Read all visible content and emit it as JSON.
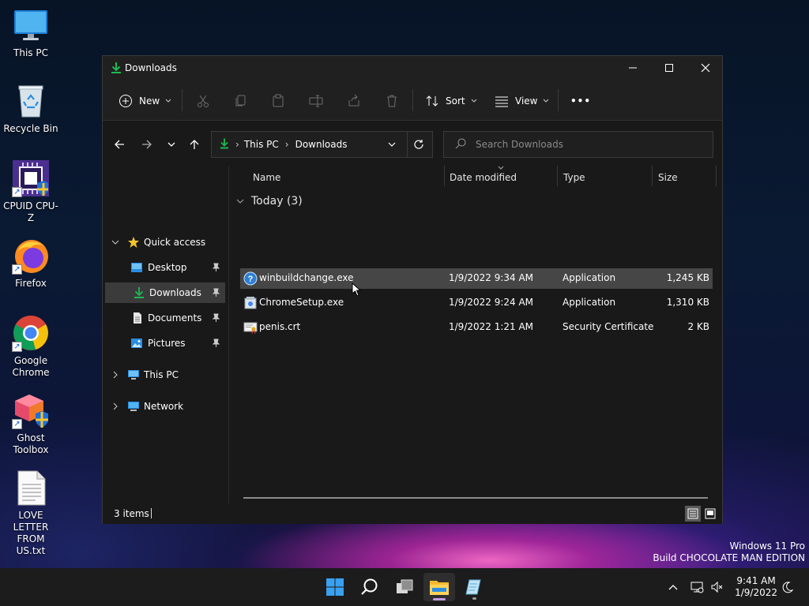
{
  "desktop": {
    "icons": [
      {
        "label": "This PC"
      },
      {
        "label": "Recycle Bin"
      },
      {
        "label": "CPUID CPU-Z"
      },
      {
        "label": "Firefox"
      },
      {
        "label": "Google Chrome"
      },
      {
        "label": "Ghost Toolbox"
      },
      {
        "label": "LOVE LETTER FROM US.txt"
      }
    ]
  },
  "window": {
    "title": "Downloads",
    "commands": {
      "new": "New",
      "sort": "Sort",
      "view": "View",
      "more": "•••"
    },
    "address": {
      "crumbs": [
        "This PC",
        "Downloads"
      ],
      "separator": "›"
    },
    "search": {
      "placeholder": "Search Downloads"
    },
    "nav": {
      "quick_access": "Quick access",
      "items": [
        {
          "label": "Desktop",
          "pinned": true
        },
        {
          "label": "Downloads",
          "pinned": true,
          "selected": true
        },
        {
          "label": "Documents",
          "pinned": true
        },
        {
          "label": "Pictures",
          "pinned": true
        }
      ],
      "this_pc": "This PC",
      "network": "Network"
    },
    "columns": {
      "name": "Name",
      "date": "Date modified",
      "type": "Type",
      "size": "Size"
    },
    "group": {
      "label": "Today (3)"
    },
    "files": [
      {
        "name": "winbuildchange.exe",
        "date": "1/9/2022 9:34 AM",
        "type": "Application",
        "size": "1,245 KB",
        "icon": "exe-question-icon",
        "selected": true
      },
      {
        "name": "ChromeSetup.exe",
        "date": "1/9/2022 9:24 AM",
        "type": "Application",
        "size": "1,310 KB",
        "icon": "installer-icon",
        "selected": false
      },
      {
        "name": "penis.crt",
        "date": "1/9/2022 1:21 AM",
        "type": "Security Certificate",
        "size": "2 KB",
        "icon": "certificate-icon",
        "selected": false
      }
    ],
    "status": {
      "item_count": "3 items"
    }
  },
  "watermark": {
    "line1": "Windows 11 Pro",
    "line2": "Build CHOCOLATE MAN EDITION"
  },
  "taskbar": {
    "clock": {
      "time": "9:41 AM",
      "date": "1/9/2022"
    }
  },
  "colors": {
    "accent_green": "#1db954",
    "window_bg": "#191919",
    "selected_row": "#464646"
  }
}
